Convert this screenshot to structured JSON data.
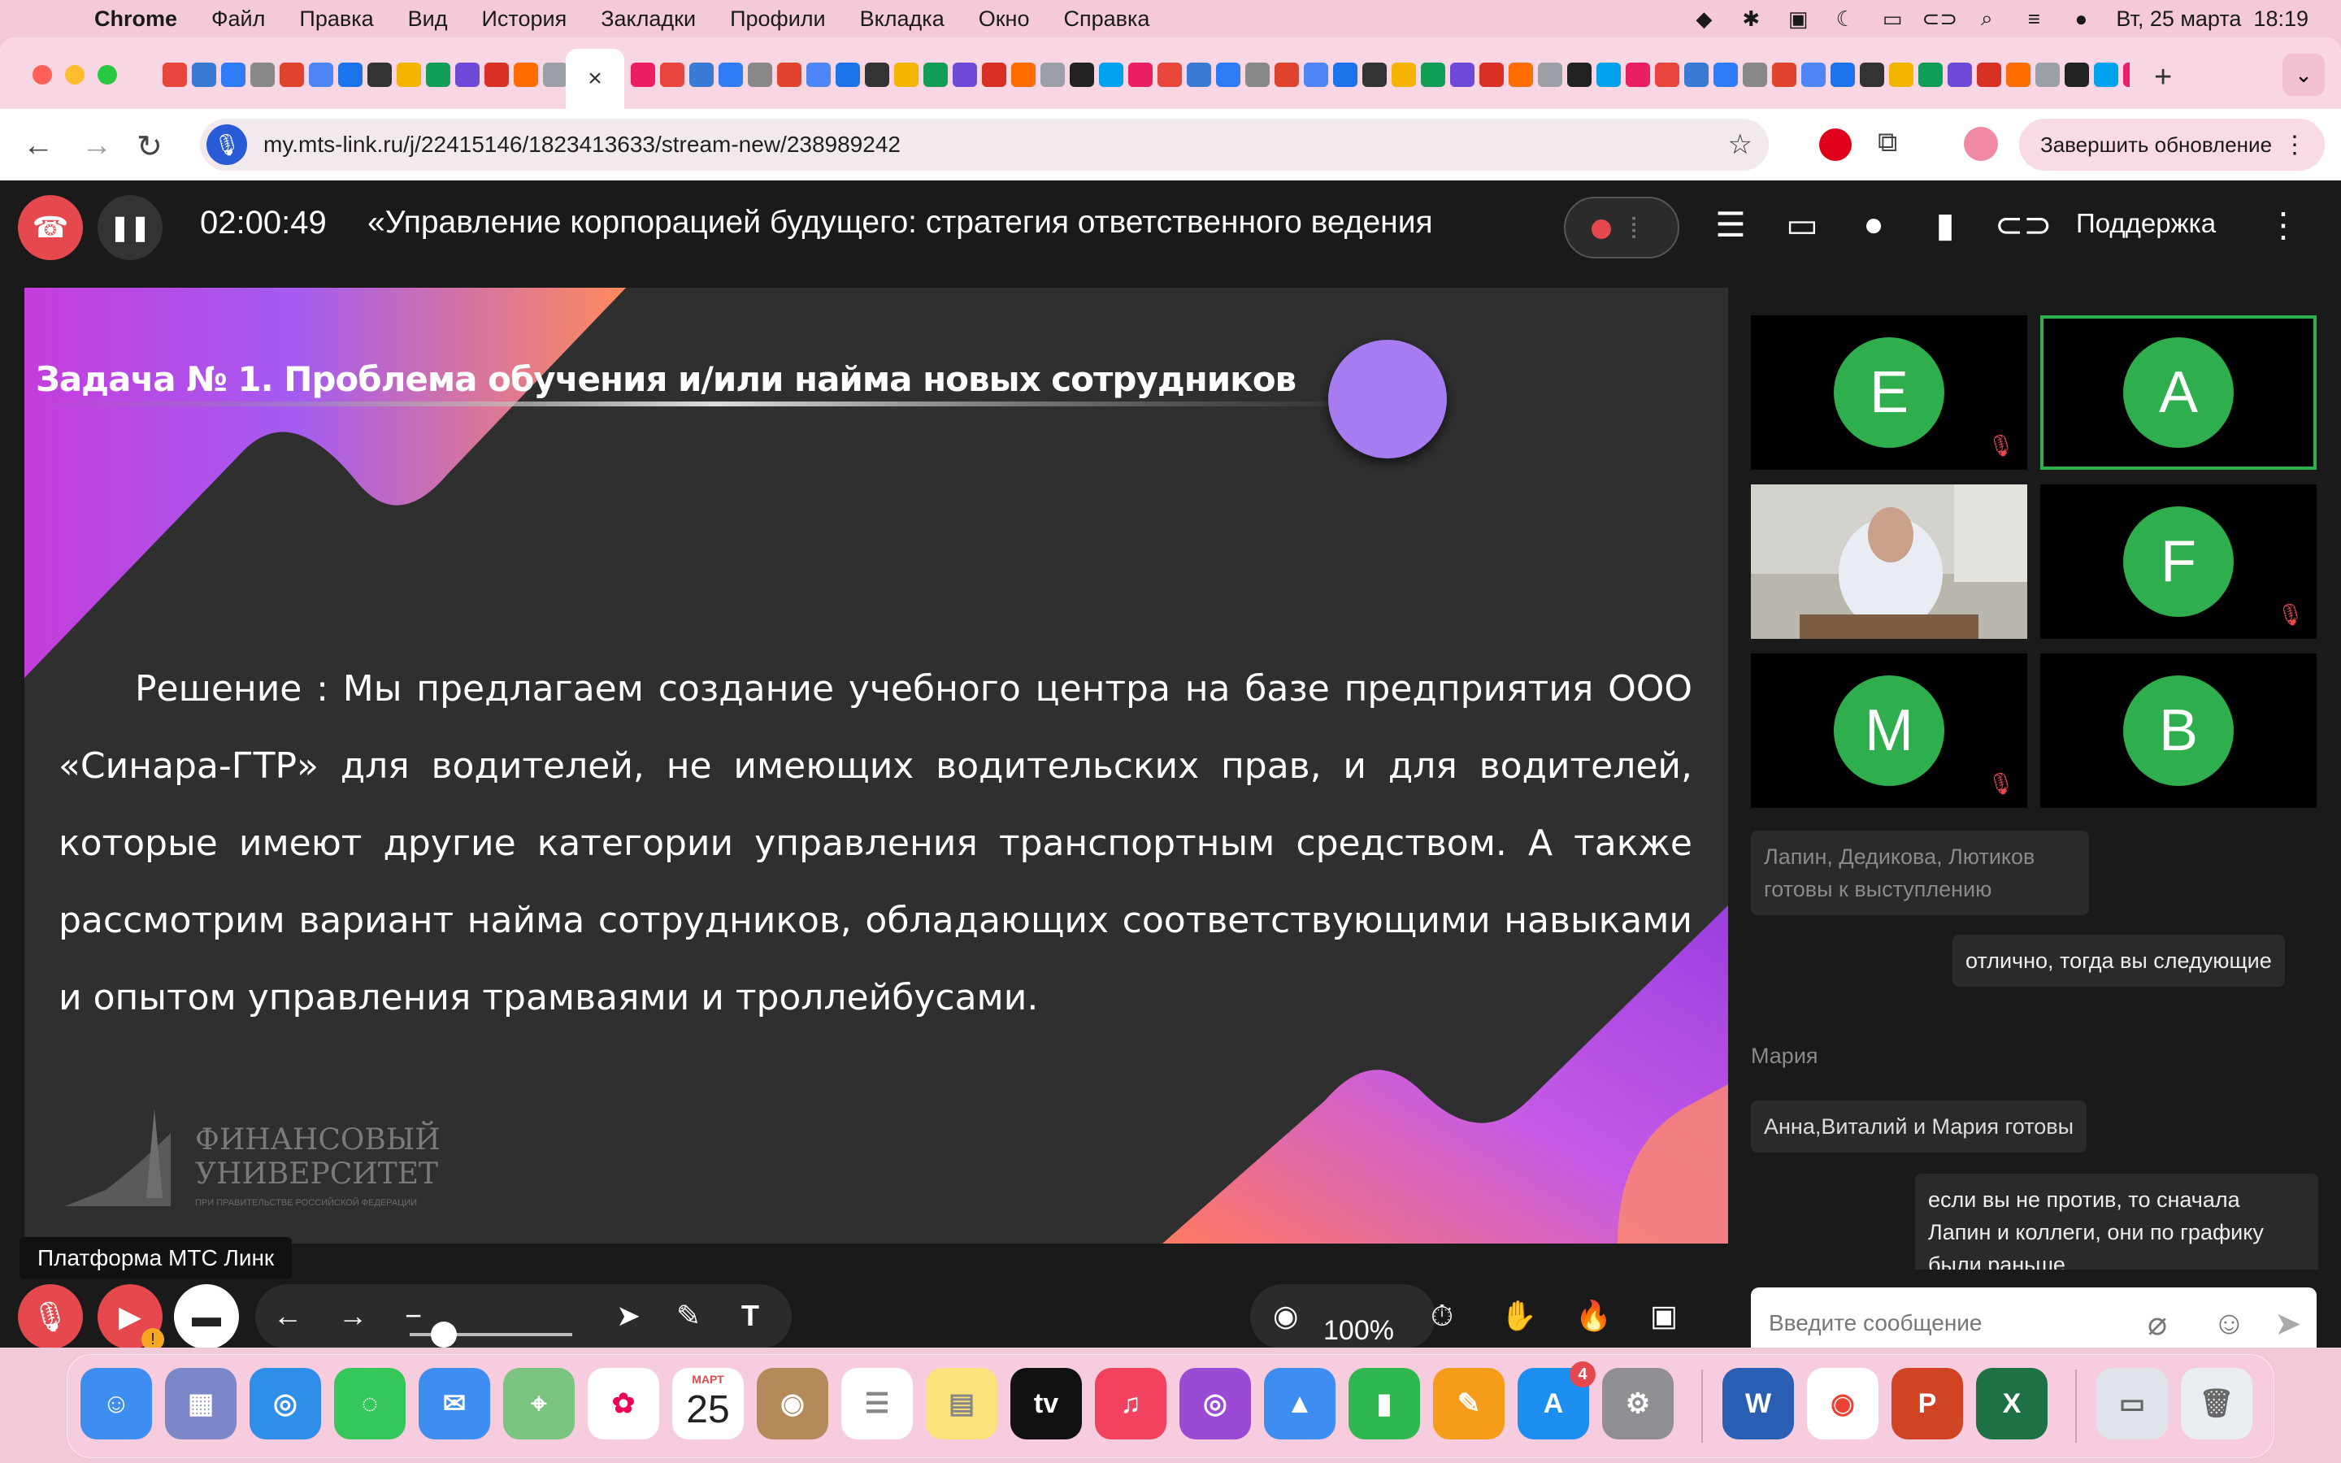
{
  "menubar": {
    "app": "Chrome",
    "items": [
      "Файл",
      "Правка",
      "Вид",
      "История",
      "Закладки",
      "Профили",
      "Вкладка",
      "Окно",
      "Справка"
    ],
    "clock": "Вт, 25 марта  18:19"
  },
  "browser": {
    "active_tab_close": "×",
    "new_tab": "+",
    "url": "my.mts-link.ru/j/22415146/1823413633/stream-new/238989242",
    "update_button": "Завершить обновление"
  },
  "webinar": {
    "timer": "02:00:49",
    "title": "«Управление корпорацией будущего: стратегия ответственного ведения",
    "support": "Поддержка",
    "tooltip": "Платформа МТС Линк",
    "view_percent": "100%"
  },
  "slide": {
    "title": "Задача № 1.  Проблема обучения и/или найма новых сотрудников",
    "body": "Решение : Мы предлагаем создание учебного центра на базе предприятия  ООО «Синара-ГТР» для водителей, не имеющих водительских прав, и для водителей, которые имеют другие категории управления транспортным средством. А также рассмотрим вариант найма сотрудников, обладающих соответствующими навыками и опытом управления трамваями и троллейбусами.",
    "logo_line1": "ФИНАНСОВЫЙ",
    "logo_line2": "УНИВЕРСИТЕТ",
    "logo_small": "ПРИ ПРАВИТЕЛЬСТВЕ РОССИЙСКОЙ ФЕДЕРАЦИИ"
  },
  "participants": [
    {
      "letter": "E",
      "muted": true
    },
    {
      "letter": "A",
      "muted": false,
      "speaking": true
    },
    {
      "letter": "",
      "video": true
    },
    {
      "letter": "F",
      "muted": true
    },
    {
      "letter": "M",
      "muted": true
    },
    {
      "letter": "B",
      "muted": false
    }
  ],
  "chat": {
    "msg1": "Лапин, Дедикова, Лютиков готовы к выступлению",
    "msg2": "отлично, тогда вы следующие",
    "author": "Мария",
    "msg3": "Анна,Виталий и Мария готовы",
    "msg4": "если вы не против, то сначала Лапин и коллеги, они по графику были раньше",
    "placeholder": "Введите сообщение"
  },
  "dock": {
    "calendar_month": "МАРТ",
    "calendar_day": "25",
    "appletv": "tv",
    "appstore_badge": "4"
  },
  "colors": {
    "accent_green": "#2fae4d",
    "danger_red": "#e5484d",
    "slide_bg": "#2f2f2f"
  }
}
